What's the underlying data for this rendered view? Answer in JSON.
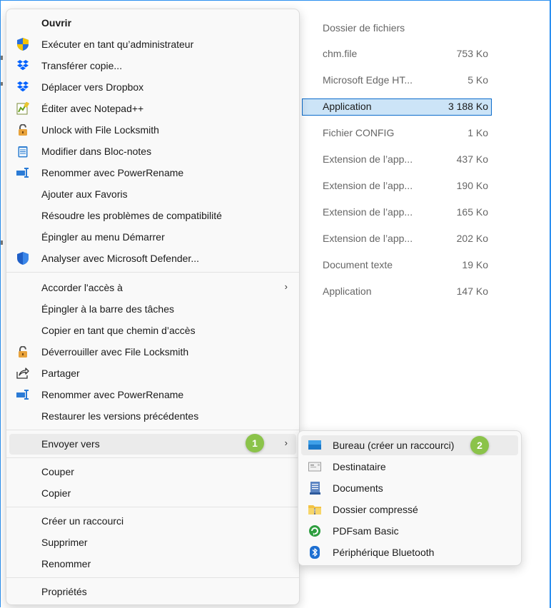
{
  "file_list": {
    "header_type": "Dossier de fichiers",
    "rows": [
      {
        "type": "chm.file",
        "size": "753 Ko"
      },
      {
        "type": "Microsoft Edge HT...",
        "size": "5 Ko"
      },
      {
        "type": "Application",
        "size": "3 188 Ko",
        "selected": true
      },
      {
        "type": "Fichier CONFIG",
        "size": "1 Ko"
      },
      {
        "type": "Extension de l’app...",
        "size": "437 Ko"
      },
      {
        "type": "Extension de l’app...",
        "size": "190 Ko"
      },
      {
        "type": "Extension de l’app...",
        "size": "165 Ko"
      },
      {
        "type": "Extension de l’app...",
        "size": "202 Ko"
      },
      {
        "type": "Document texte",
        "size": "19 Ko"
      },
      {
        "type": "Application",
        "size": "147 Ko"
      }
    ]
  },
  "menu": {
    "items": [
      {
        "label": "Ouvrir",
        "icon": "none"
      },
      {
        "label": "Exécuter en tant qu’administrateur",
        "icon": "uac-shield-icon"
      },
      {
        "label": "Transférer copie...",
        "icon": "dropbox-icon"
      },
      {
        "label": "Déplacer vers Dropbox",
        "icon": "dropbox-icon"
      },
      {
        "label": "Éditer avec Notepad++",
        "icon": "notepadpp-icon"
      },
      {
        "label": "Unlock with File Locksmith",
        "icon": "padlock-icon"
      },
      {
        "label": "Modifier dans Bloc-notes",
        "icon": "notepad-icon"
      },
      {
        "label": "Renommer avec PowerRename",
        "icon": "powerrename-icon"
      },
      {
        "label": "Ajouter aux Favoris",
        "icon": "none"
      },
      {
        "label": "Résoudre les problèmes de compatibilité",
        "icon": "none"
      },
      {
        "label": "Épingler au menu Démarrer",
        "icon": "none"
      },
      {
        "label": "Analyser avec Microsoft Defender...",
        "icon": "defender-shield-icon"
      },
      {
        "label": "Accorder l'accès à",
        "icon": "none",
        "submenu": true
      },
      {
        "label": "Épingler à la barre des tâches",
        "icon": "none"
      },
      {
        "label": "Copier en tant que chemin d’accès",
        "icon": "none"
      },
      {
        "label": "Déverrouiller avec File Locksmith",
        "icon": "padlock-icon"
      },
      {
        "label": "Partager",
        "icon": "share-icon"
      },
      {
        "label": "Renommer avec PowerRename",
        "icon": "powerrename-icon"
      },
      {
        "label": "Restaurer les versions précédentes",
        "icon": "none"
      },
      {
        "label": "Envoyer vers",
        "icon": "none",
        "submenu": true
      },
      {
        "label": "Couper",
        "icon": "none"
      },
      {
        "label": "Copier",
        "icon": "none"
      },
      {
        "label": "Créer un raccourci",
        "icon": "none"
      },
      {
        "label": "Supprimer",
        "icon": "none"
      },
      {
        "label": "Renommer",
        "icon": "none"
      },
      {
        "label": "Propriétés",
        "icon": "none"
      }
    ],
    "chevron": "›"
  },
  "submenu": {
    "items": [
      {
        "label": "Bureau (créer un raccourci)",
        "icon": "desktop-icon"
      },
      {
        "label": "Destinataire",
        "icon": "mail-recipient-icon"
      },
      {
        "label": "Documents",
        "icon": "documents-icon"
      },
      {
        "label": "Dossier compressé",
        "icon": "zip-folder-icon"
      },
      {
        "label": "PDFsam Basic",
        "icon": "pdfsam-icon"
      },
      {
        "label": "Périphérique Bluetooth",
        "icon": "bluetooth-icon"
      }
    ]
  },
  "badges": {
    "step1": "1",
    "step2": "2"
  },
  "colors": {
    "accent": "#0b6bcb",
    "badge": "#8bc34a",
    "selection": "#cce4f7"
  }
}
